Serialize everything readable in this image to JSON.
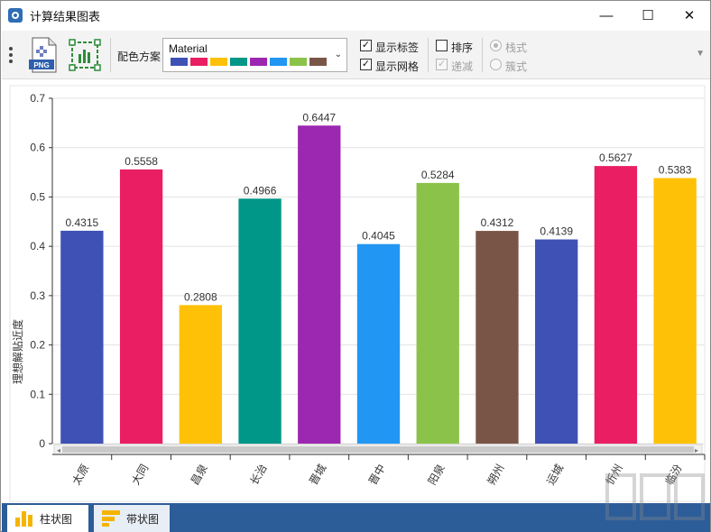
{
  "window": {
    "title": "计算结果图表",
    "minimize": "—",
    "maximize": "☐",
    "close": "✕"
  },
  "toolbar": {
    "png_label": "PNG",
    "color_scheme_label": "配色方案",
    "color_scheme_value": "Material",
    "palette": [
      "#3f51b5",
      "#e91e63",
      "#ffc107",
      "#009688",
      "#9c27b0",
      "#2196f3",
      "#8bc34a",
      "#795548"
    ],
    "show_labels": {
      "label": "显示标签",
      "checked": true
    },
    "show_grid": {
      "label": "显示网格",
      "checked": true
    },
    "sort": {
      "label": "排序",
      "checked": false
    },
    "descending": {
      "label": "递减",
      "checked": true,
      "disabled": true
    },
    "stack_mode": {
      "label": "栈式",
      "checked": true,
      "disabled": true
    },
    "cluster_mode": {
      "label": "簇式",
      "checked": false,
      "disabled": true
    }
  },
  "chart_data": {
    "type": "bar",
    "categories": [
      "太原",
      "大同",
      "昌泉",
      "长治",
      "晋城",
      "晋中",
      "阳泉",
      "朔州",
      "运城",
      "忻州",
      "临汾"
    ],
    "values": [
      0.4315,
      0.5558,
      0.2808,
      0.4966,
      0.6447,
      0.4045,
      0.5284,
      0.4312,
      0.4139,
      0.5627,
      0.5383
    ],
    "value_labels": [
      "0.4315",
      "0.5558",
      "0.2808",
      "0.4966",
      "0.6447",
      "0.4045",
      "0.5284",
      "0.4312",
      "0.4139",
      "0.5627",
      "0.5383"
    ],
    "colors": [
      "#3f51b5",
      "#e91e63",
      "#ffc107",
      "#009688",
      "#9c27b0",
      "#2196f3",
      "#8bc34a",
      "#795548",
      "#3f51b5",
      "#e91e63",
      "#ffc107"
    ],
    "ylabel": "理想解贴近度",
    "yticks": [
      "0",
      "0.1",
      "0.2",
      "0.3",
      "0.4",
      "0.5",
      "0.6",
      "0.7"
    ],
    "ylim": [
      0,
      0.7
    ],
    "grid": true,
    "legend": "none"
  },
  "tabs": [
    {
      "label": "柱状图",
      "active": true
    },
    {
      "label": "带状图",
      "active": false
    }
  ]
}
